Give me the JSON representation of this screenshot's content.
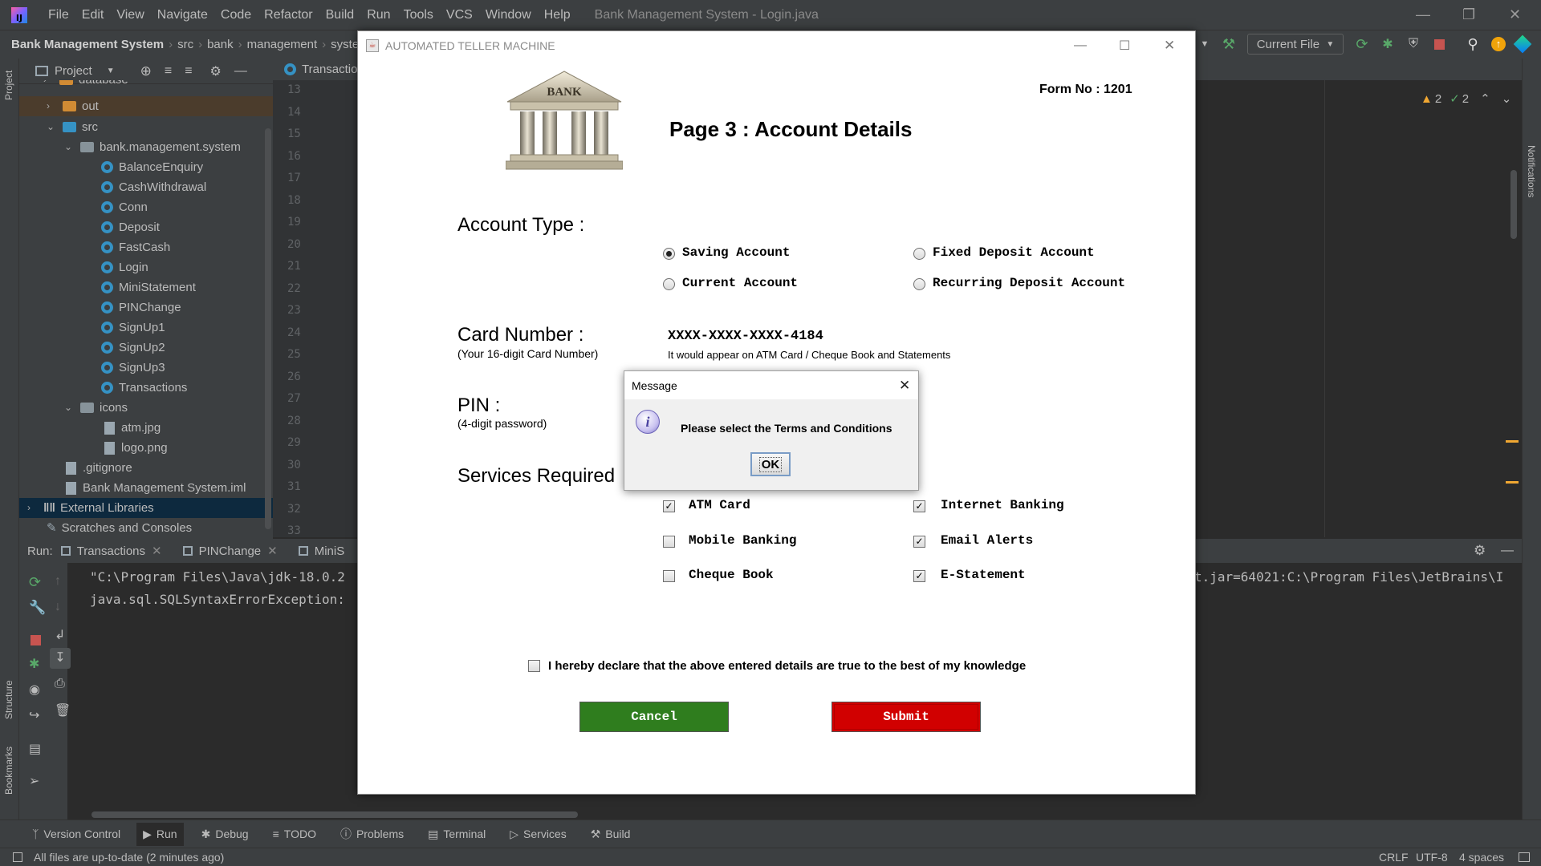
{
  "menubar": {
    "items": [
      "File",
      "Edit",
      "View",
      "Navigate",
      "Code",
      "Refactor",
      "Build",
      "Run",
      "Tools",
      "VCS",
      "Window",
      "Help"
    ],
    "window_title": "Bank Management System - Login.java"
  },
  "navbar": {
    "project": "Bank Management System",
    "crumbs": [
      "src",
      "bank",
      "management",
      "syste"
    ],
    "current_file": "Current File"
  },
  "project_panel": {
    "title": "Project",
    "items": {
      "database": "database",
      "out": "out",
      "src": "src",
      "package": "bank.management.system",
      "classes": [
        "BalanceEnquiry",
        "CashWithdrawal",
        "Conn",
        "Deposit",
        "FastCash",
        "Login",
        "MiniStatement",
        "PINChange",
        "SignUp1",
        "SignUp2",
        "SignUp3",
        "Transactions"
      ],
      "icons_folder": "icons",
      "icon_files": [
        "atm.jpg",
        "logo.png"
      ],
      "gitignore": ".gitignore",
      "iml": "Bank Management System.iml",
      "external": "External Libraries",
      "scratches": "Scratches and Consoles"
    }
  },
  "editor": {
    "tab": "Transactio",
    "line_numbers": [
      "13",
      "14",
      "15",
      "16",
      "17",
      "18",
      "19",
      "20",
      "21",
      "22",
      "23",
      "24",
      "25",
      "26",
      "27",
      "28",
      "29",
      "30",
      "31",
      "32",
      "33"
    ],
    "warnings": "2",
    "checks": "2"
  },
  "run_panel": {
    "label": "Run:",
    "tabs": [
      "Transactions",
      "PINChange",
      "MiniS"
    ],
    "console_line1": "\"C:\\Program Files\\Java\\jdk-18.0.2",
    "console_line1_right": "t.jar=64021:C:\\Program Files\\JetBrains\\I",
    "console_line2": "java.sql.SQLSyntaxErrorException:"
  },
  "bottom_tools": [
    "Version Control",
    "Run",
    "Debug",
    "TODO",
    "Problems",
    "Terminal",
    "Services",
    "Build"
  ],
  "side_labels": {
    "project": "Project",
    "structure": "Structure",
    "bookmarks": "Bookmarks",
    "notifications": "Notifications"
  },
  "status": {
    "message": "All files are up-to-date (2 minutes ago)",
    "line_sep": "CRLF",
    "encoding": "UTF-8",
    "indent": "4 spaces"
  },
  "atm": {
    "window_title": "AUTOMATED TELLER MACHINE",
    "bank_label": "BANK",
    "form_no": "Form No : 1201",
    "page_title": "Page 3 : Account Details",
    "account_type_label": "Account Type :",
    "account_options": [
      "Saving Account",
      "Fixed Deposit Account",
      "Current Account",
      "Recurring Deposit Account"
    ],
    "selected_account": "Saving Account",
    "card_label": "Card Number :",
    "card_sub": "(Your 16-digit Card Number)",
    "card_value": "XXXX-XXXX-XXXX-4184",
    "card_note": "It would appear on ATM Card / Cheque Book and Statements",
    "pin_label": "PIN :",
    "pin_sub": "(4-digit password)",
    "services_label": "Services Required",
    "services": [
      {
        "label": "ATM Card",
        "checked": true
      },
      {
        "label": "Internet Banking",
        "checked": true
      },
      {
        "label": "Mobile Banking",
        "checked": false
      },
      {
        "label": "Email Alerts",
        "checked": true
      },
      {
        "label": "Cheque Book",
        "checked": false
      },
      {
        "label": "E-Statement",
        "checked": true
      }
    ],
    "declaration": "I hereby declare that the above entered details are true to the best of my knowledge",
    "declaration_checked": false,
    "cancel": "Cancel",
    "submit": "Submit",
    "cancel_color": "#2f7d1e",
    "submit_color": "#d10000"
  },
  "dialog": {
    "title": "Message",
    "message": "Please select the Terms and Conditions",
    "ok": "OK",
    "icon": "info-icon"
  }
}
